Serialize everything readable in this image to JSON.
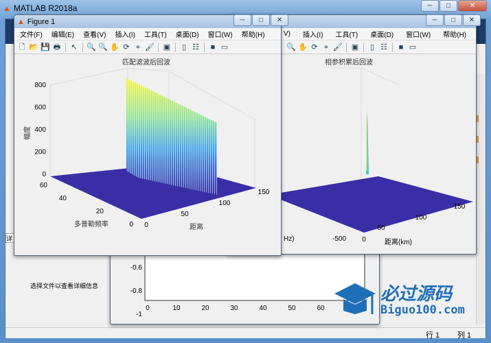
{
  "main_window": {
    "title": "MATLAB R2018a",
    "detail_text": "选择文件以查看详细信息",
    "status_row": "行 1",
    "status_col": "列 1",
    "side_tab": "详"
  },
  "figure1": {
    "title": "Figure 1",
    "menu": [
      "文件(F)",
      "编辑(E)",
      "查看(V)",
      "插入(I)",
      "工具(T)",
      "桌面(D)",
      "窗口(W)",
      "帮助(H)"
    ],
    "plot": {
      "title": "匹配滤波后回波",
      "zlabel": "幅度",
      "ylabel": "多普勒频率",
      "xlabel": "距离",
      "zticks": [
        "0",
        "200",
        "400",
        "600",
        "800"
      ],
      "yticks": [
        "0",
        "20",
        "40",
        "60"
      ],
      "xticks": [
        "0",
        "50",
        "100",
        "150"
      ]
    }
  },
  "figure2": {
    "menu": [
      "插入(I)",
      "工具(T)",
      "桌面(D)",
      "窗口(W)",
      "帮助(H)"
    ],
    "menu_partial": "V)",
    "plot": {
      "title": "相参积累后回波",
      "xlabel": "距离(km)",
      "ylabel_partial": "Hz)",
      "yticks": [
        "-500",
        "0"
      ],
      "xticks": [
        "0",
        "50",
        "100",
        "150"
      ]
    }
  },
  "figure3": {
    "yticks": [
      "-0.6",
      "-0.8",
      "-1"
    ],
    "xticks": [
      "0",
      "10",
      "20",
      "30",
      "40",
      "50",
      "60"
    ]
  },
  "watermark": {
    "title": "必过源码",
    "url": "Biguo100.com"
  },
  "colors": {
    "surface_low": "#3b2fa8",
    "surface_high": "#f9f442",
    "accent": "#1f6fb8"
  }
}
